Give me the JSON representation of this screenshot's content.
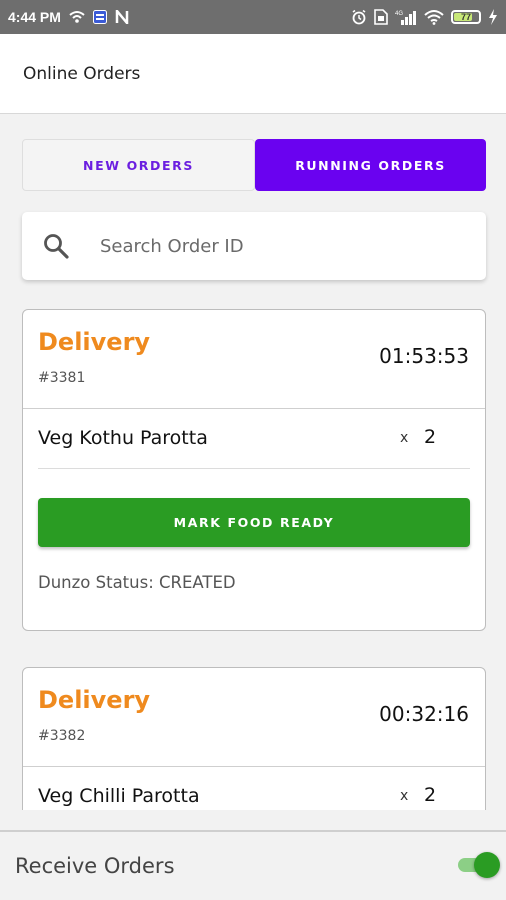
{
  "status_bar": {
    "time": "4:44 PM",
    "battery_level": "77",
    "left_icons": [
      "wifi-calling-icon",
      "app-notification-icon",
      "n-app-icon"
    ],
    "right_icons": [
      "alarm-icon",
      "sim-icon",
      "4g-signal-icon",
      "wifi-icon",
      "battery-icon",
      "charging-icon"
    ]
  },
  "app_bar": {
    "title": "Online Orders"
  },
  "tabs": [
    {
      "label": "NEW ORDERS",
      "active": false
    },
    {
      "label": "RUNNING ORDERS",
      "active": true
    }
  ],
  "search": {
    "placeholder": "Search Order ID",
    "value": ""
  },
  "orders": [
    {
      "type": "Delivery",
      "id": "#3381",
      "timer": "01:53:53",
      "items": [
        {
          "name": "Veg Kothu Parotta",
          "x": "x",
          "qty": "2"
        }
      ],
      "action_label": "MARK FOOD READY",
      "status": "Dunzo Status: CREATED"
    },
    {
      "type": "Delivery",
      "id": "#3382",
      "timer": "00:32:16",
      "items": [
        {
          "name": "Veg Chilli Parotta",
          "x": "x",
          "qty": "2"
        }
      ]
    }
  ],
  "bottom_bar": {
    "label": "Receive Orders",
    "toggle_on": true
  },
  "colors": {
    "accent": "#6a02f0",
    "order_type": "#ef8a1e",
    "primary_button": "#2a9c23",
    "status_bar": "#6e6e6e"
  }
}
